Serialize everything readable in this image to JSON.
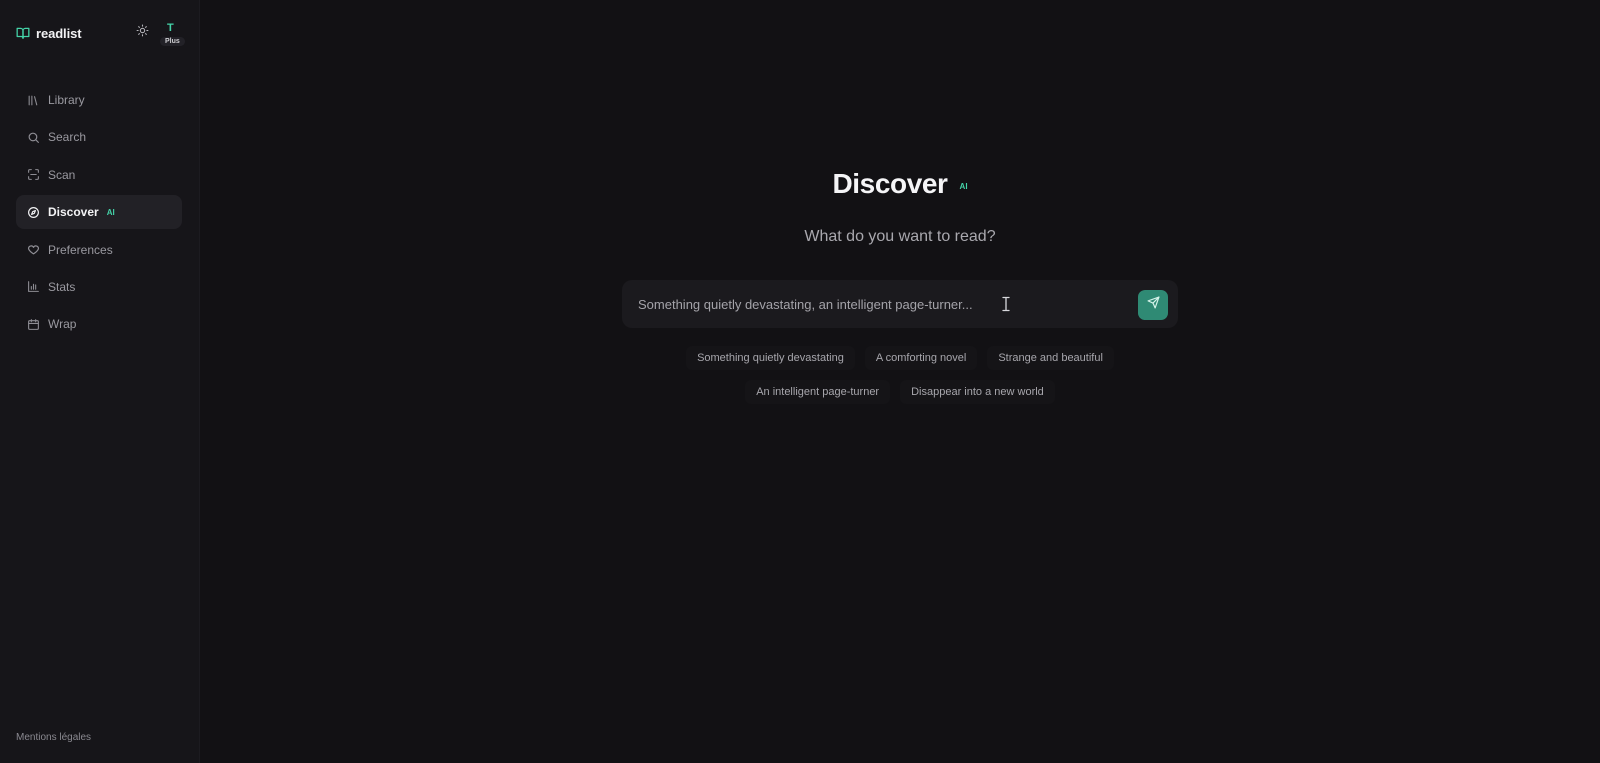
{
  "app": {
    "name": "readlist",
    "user_initial": "T",
    "plan": "Plus"
  },
  "sidebar": {
    "items": [
      {
        "label": "Library",
        "icon": "library-icon"
      },
      {
        "label": "Search",
        "icon": "search-icon"
      },
      {
        "label": "Scan",
        "icon": "scan-icon"
      },
      {
        "label": "Discover",
        "icon": "compass-icon",
        "badge": "AI",
        "active": true
      },
      {
        "label": "Preferences",
        "icon": "heart-icon"
      },
      {
        "label": "Stats",
        "icon": "bar-chart-icon"
      },
      {
        "label": "Wrap",
        "icon": "calendar-icon"
      }
    ],
    "legal_link": "Mentions légales"
  },
  "main": {
    "title": "Discover",
    "title_badge": "AI",
    "subtitle": "What do you want to read?",
    "prompt": {
      "placeholder": "Something quietly devastating, an intelligent page-turner...",
      "value": ""
    },
    "suggestions_row1": [
      "Something quietly devastating",
      "A comforting novel",
      "Strange and beautiful"
    ],
    "suggestions_row2": [
      "An intelligent page-turner",
      "Disappear into a new world"
    ]
  },
  "colors": {
    "accent": "#44d3a8",
    "send_button": "#2f8a74",
    "background": "#121114",
    "sidebar": "#161519"
  }
}
